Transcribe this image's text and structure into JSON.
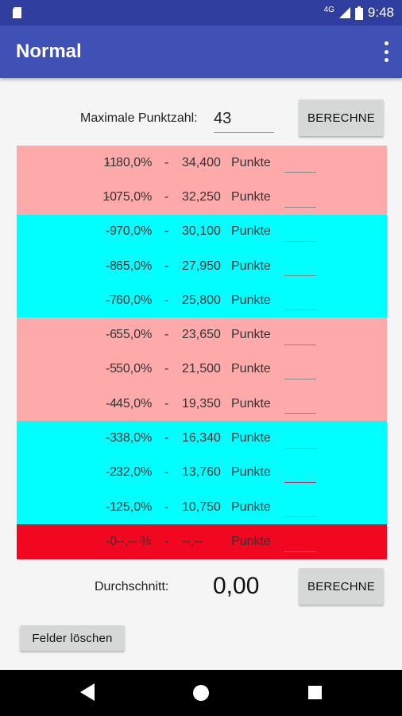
{
  "status_bar": {
    "network": "4G",
    "time": "9:48",
    "icons": [
      "sd-card-icon",
      "signal-icon",
      "battery-icon"
    ]
  },
  "app_bar": {
    "title": "Normal",
    "overflow_icon": "more-vert-icon"
  },
  "max_points": {
    "label": "Maximale Punktzahl:",
    "value": "43",
    "button": "BERECHNE"
  },
  "colors": {
    "pink": "#ffaaaa",
    "cyan": "#00ffff",
    "red": "#f20721",
    "app_bar": "#3f51b5",
    "status_bar": "#303f9f"
  },
  "grades": [
    {
      "num": "11",
      "pct": "80,0%",
      "points": "34,400",
      "unit": "Punkte",
      "color": "pink"
    },
    {
      "num": "10",
      "pct": "75,0%",
      "points": "32,250",
      "unit": "Punkte",
      "color": "pink"
    },
    {
      "num": "9",
      "pct": "70,0%",
      "points": "30,100",
      "unit": "Punkte",
      "color": "cyan"
    },
    {
      "num": "8",
      "pct": "65,0%",
      "points": "27,950",
      "unit": "Punkte",
      "color": "cyan"
    },
    {
      "num": "7",
      "pct": "60,0%",
      "points": "25,800",
      "unit": "Punkte",
      "color": "cyan"
    },
    {
      "num": "6",
      "pct": "55,0%",
      "points": "23,650",
      "unit": "Punkte",
      "color": "pink"
    },
    {
      "num": "5",
      "pct": "50,0%",
      "points": "21,500",
      "unit": "Punkte",
      "color": "pink"
    },
    {
      "num": "4",
      "pct": "45,0%",
      "points": "19,350",
      "unit": "Punkte",
      "color": "pink"
    },
    {
      "num": "3",
      "pct": "38,0%",
      "points": "16,340",
      "unit": "Punkte",
      "color": "cyan"
    },
    {
      "num": "2",
      "pct": "32,0%",
      "points": "13,760",
      "unit": "Punkte",
      "color": "cyan"
    },
    {
      "num": "1",
      "pct": "25,0%",
      "points": "10,750",
      "unit": "Punkte",
      "color": "cyan"
    },
    {
      "num": "0",
      "pct": "--,-- %",
      "points": "--,--",
      "unit": "Punkte",
      "color": "red"
    }
  ],
  "average": {
    "label": "Durchschnitt:",
    "value": "0,00",
    "button": "BERECHNE"
  },
  "clear_button": "Felder löschen",
  "nav_bar": {
    "icons": [
      "back-icon",
      "home-icon",
      "recents-icon"
    ]
  }
}
